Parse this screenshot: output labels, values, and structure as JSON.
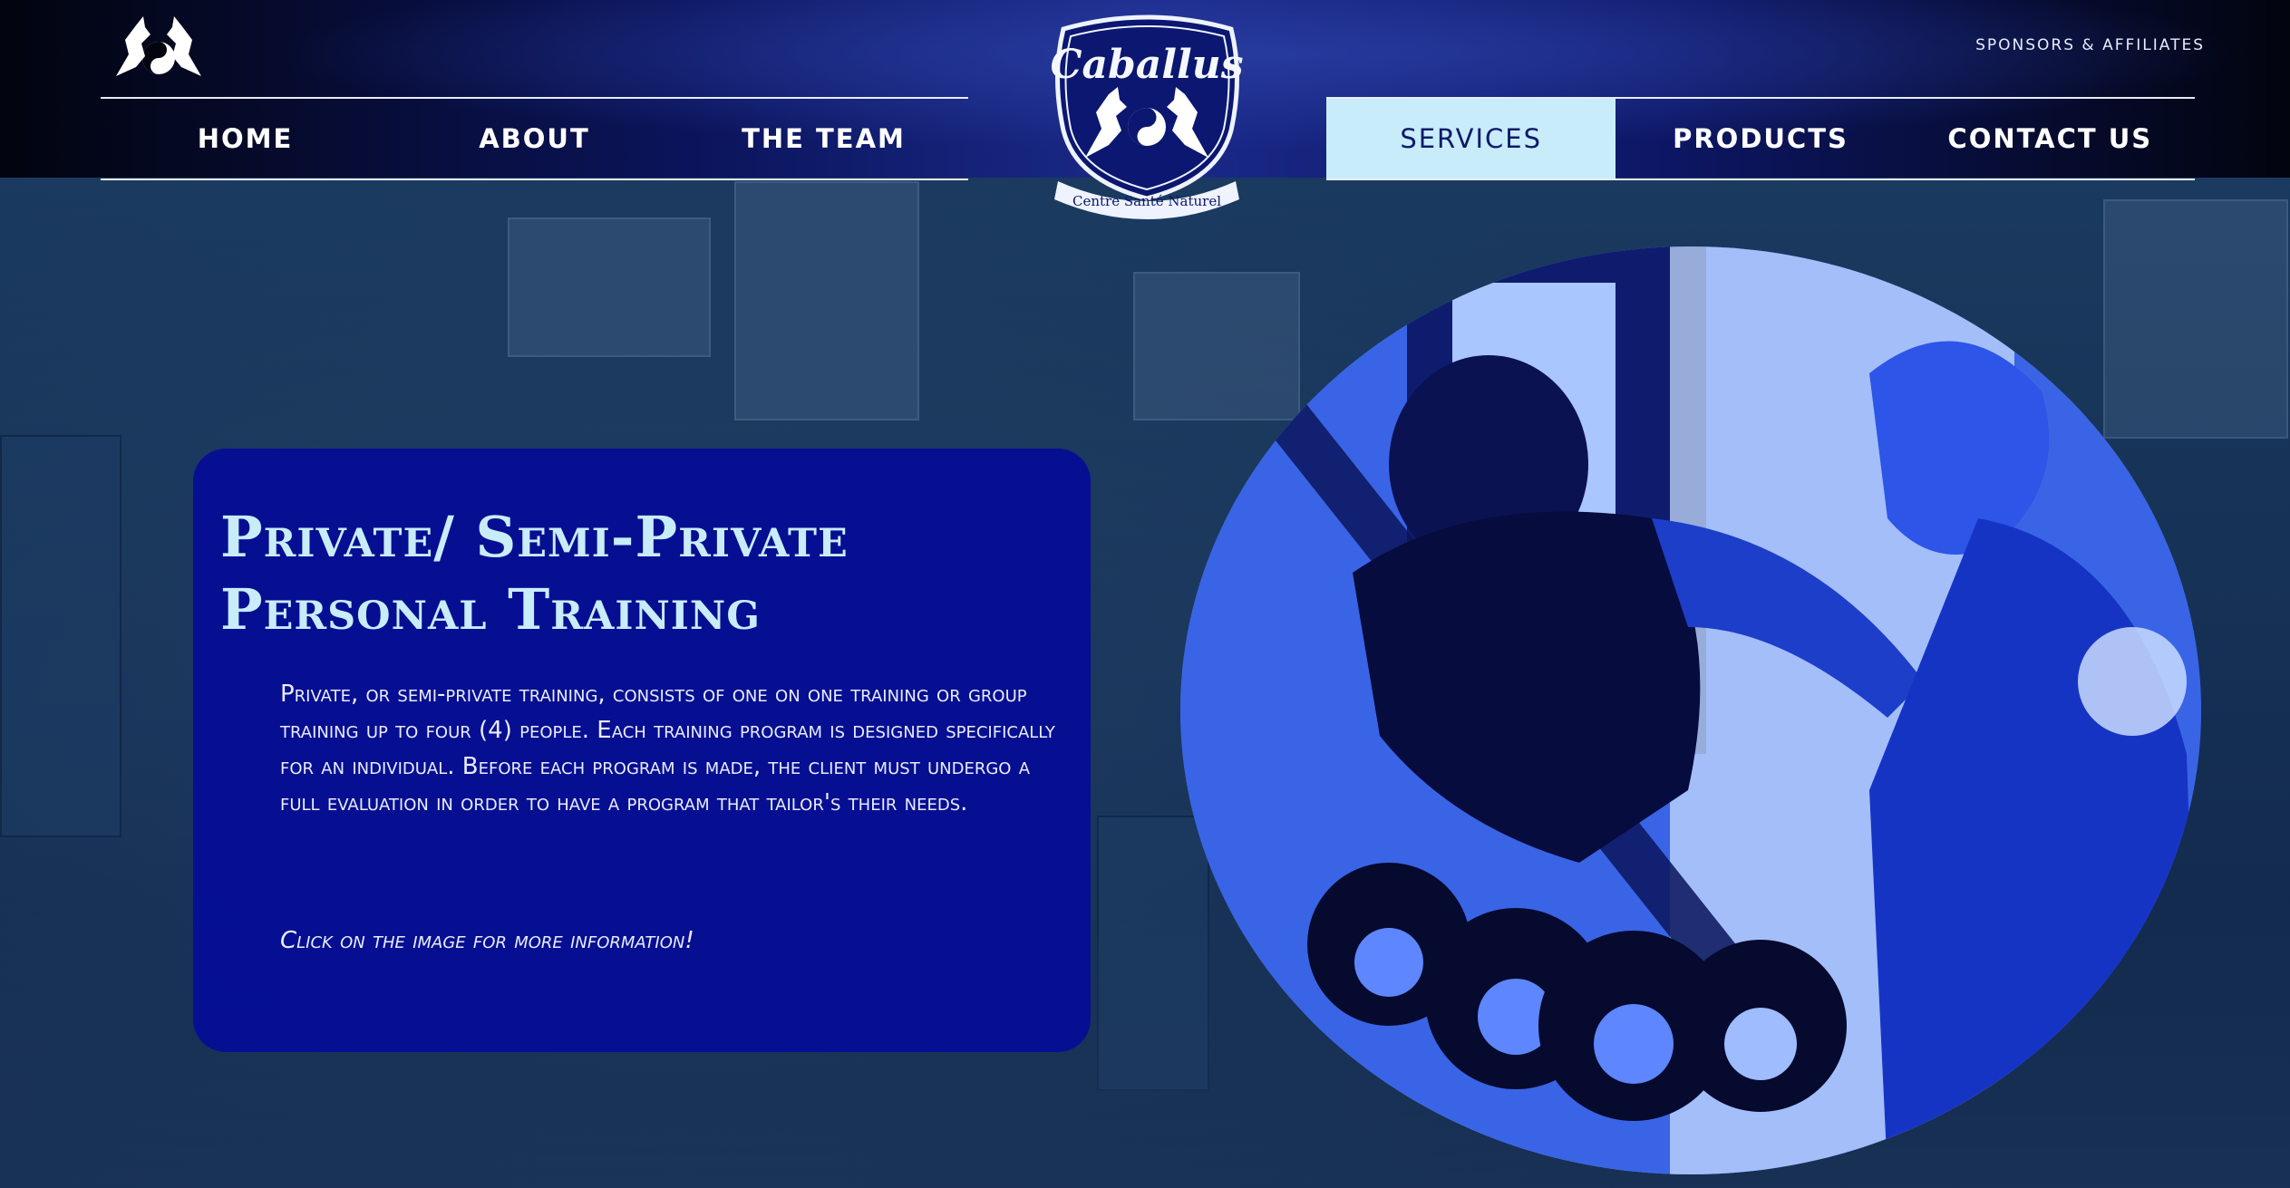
{
  "header": {
    "sponsors_label": "SPONSORS & AFFILIATES",
    "crest_text": "Caballus",
    "crest_subtext": "Centre Santé Naturel",
    "nav_left": [
      {
        "label": "HOME"
      },
      {
        "label": "ABOUT"
      },
      {
        "label": "THE TEAM"
      }
    ],
    "nav_right": [
      {
        "label": "SERVICES",
        "active": true
      },
      {
        "label": "PRODUCTS"
      },
      {
        "label": "CONTACT US"
      }
    ]
  },
  "main": {
    "title_line1": "Private/ Semi-Private",
    "title_line2": "Personal Training",
    "body": "Private, or semi-private training, consists of one on one training or group training up to four (4) people. Each training program is designed specifically for an individual. Before each program is made, the client must undergo a full evaluation in order to have a program that tailor's their needs.",
    "cta": "Click on the image for more information!"
  },
  "colors": {
    "card": "#040c96",
    "title": "#c9ecfb",
    "active_tab": "#c9ecfb",
    "header_dark": "#02040e"
  }
}
